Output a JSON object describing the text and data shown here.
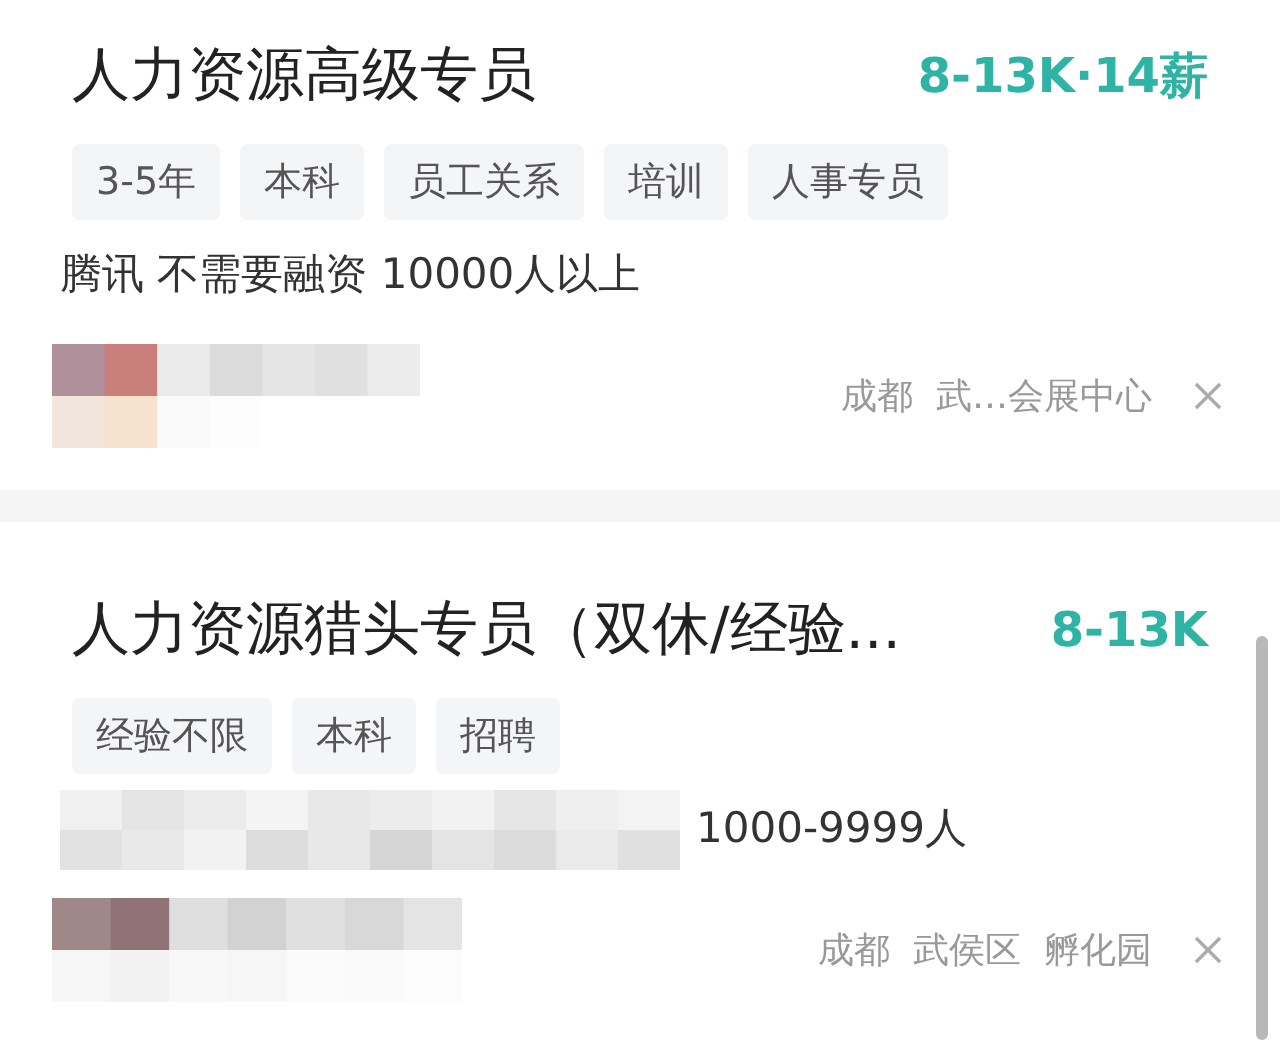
{
  "jobs": [
    {
      "title": "人力资源高级专员",
      "salary": "8-13K·14薪",
      "tags": [
        "3-5年",
        "本科",
        "员工关系",
        "培训",
        "人事专员"
      ],
      "company": "腾讯 不需要融资 10000人以上",
      "location": "成都  武…会展中心"
    },
    {
      "title": "人力资源猎头专员（双休/经验...",
      "salary": "8-13K",
      "tags": [
        "经验不限",
        "本科",
        "招聘"
      ],
      "company": "1000-9999人",
      "location": "成都  武侯区  孵化园"
    }
  ]
}
